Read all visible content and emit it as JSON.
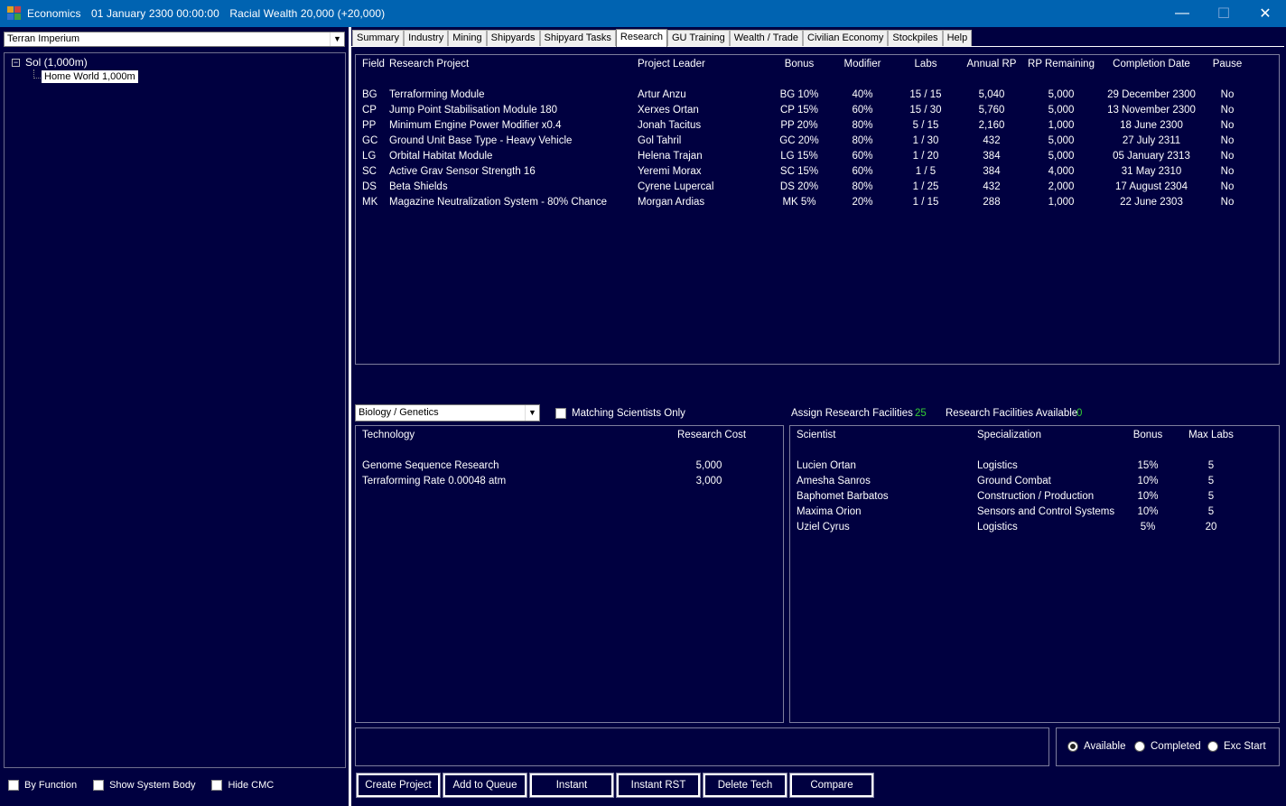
{
  "titlebar": {
    "app_name": "Economics",
    "datetime": "01 January 2300 00:00:00",
    "wealth": "Racial Wealth 20,000 (+20,000)",
    "minimize": "—",
    "maximize": "☐",
    "close": "✕"
  },
  "left": {
    "empire_combo": "Terran Imperium",
    "tree": {
      "expander": "−",
      "system": "Sol  (1,000m)",
      "body": "Home World  1,000m"
    },
    "checks": {
      "by_function": "By Function",
      "show_system_body": "Show System Body",
      "hide_cmc": "Hide CMC"
    }
  },
  "tabs": [
    "Summary",
    "Industry",
    "Mining",
    "Shipyards",
    "Shipyard Tasks",
    "Research",
    "GU Training",
    "Wealth / Trade",
    "Civilian Economy",
    "Stockpiles",
    "Help"
  ],
  "active_tab": "Research",
  "projects": {
    "headers": {
      "field": "Field",
      "project": "Research Project",
      "leader": "Project Leader",
      "bonus": "Bonus",
      "modifier": "Modifier",
      "labs": "Labs",
      "annual_rp": "Annual RP",
      "rp_remaining": "RP Remaining",
      "completion": "Completion Date",
      "pause": "Pause"
    },
    "rows": [
      {
        "field": "BG",
        "project": "Terraforming Module",
        "leader": "Artur Anzu",
        "bonus": "BG 10%",
        "modifier": "40%",
        "labs": "15 / 15",
        "annual_rp": "5,040",
        "rp_remaining": "5,000",
        "completion": "29 December 2300",
        "pause": "No"
      },
      {
        "field": "CP",
        "project": "Jump Point Stabilisation Module 180",
        "leader": "Xerxes Ortan",
        "bonus": "CP 15%",
        "modifier": "60%",
        "labs": "15 / 30",
        "annual_rp": "5,760",
        "rp_remaining": "5,000",
        "completion": "13 November 2300",
        "pause": "No"
      },
      {
        "field": "PP",
        "project": "Minimum Engine Power Modifier x0.4",
        "leader": "Jonah Tacitus",
        "bonus": "PP 20%",
        "modifier": "80%",
        "labs": "5 / 15",
        "annual_rp": "2,160",
        "rp_remaining": "1,000",
        "completion": "18 June 2300",
        "pause": "No"
      },
      {
        "field": "GC",
        "project": "Ground Unit Base Type - Heavy Vehicle",
        "leader": "Gol Tahril",
        "bonus": "GC 20%",
        "modifier": "80%",
        "labs": "1 / 30",
        "annual_rp": "432",
        "rp_remaining": "5,000",
        "completion": "27 July 2311",
        "pause": "No"
      },
      {
        "field": "LG",
        "project": "Orbital Habitat Module",
        "leader": "Helena Trajan",
        "bonus": "LG 15%",
        "modifier": "60%",
        "labs": "1 / 20",
        "annual_rp": "384",
        "rp_remaining": "5,000",
        "completion": "05 January 2313",
        "pause": "No"
      },
      {
        "field": "SC",
        "project": "Active Grav Sensor Strength 16",
        "leader": "Yeremi Morax",
        "bonus": "SC 15%",
        "modifier": "60%",
        "labs": "1 / 5",
        "annual_rp": "384",
        "rp_remaining": "4,000",
        "completion": "31 May 2310",
        "pause": "No"
      },
      {
        "field": "DS",
        "project": "Beta Shields",
        "leader": "Cyrene Lupercal",
        "bonus": "DS 20%",
        "modifier": "80%",
        "labs": "1 / 25",
        "annual_rp": "432",
        "rp_remaining": "2,000",
        "completion": "17 August 2304",
        "pause": "No"
      },
      {
        "field": "MK",
        "project": "Magazine Neutralization System - 80% Chance",
        "leader": "Morgan Ardias",
        "bonus": "MK 5%",
        "modifier": "20%",
        "labs": "1 / 15",
        "annual_rp": "288",
        "rp_remaining": "1,000",
        "completion": "22 June 2303",
        "pause": "No"
      }
    ]
  },
  "research_field_combo": "Biology / Genetics",
  "matching_scientists": "Matching Scientists Only",
  "facilities": {
    "assign_label": "Assign Research Facilities",
    "assign_value": "25",
    "available_label": "Research Facilities Available",
    "available_value": "0"
  },
  "technology": {
    "headers": {
      "technology": "Technology",
      "cost": "Research Cost"
    },
    "rows": [
      {
        "name": "Genome Sequence Research",
        "cost": "5,000"
      },
      {
        "name": "Terraforming Rate 0.00048 atm",
        "cost": "3,000"
      }
    ]
  },
  "scientists": {
    "headers": {
      "scientist": "Scientist",
      "specialization": "Specialization",
      "bonus": "Bonus",
      "max_labs": "Max Labs"
    },
    "rows": [
      {
        "name": "Lucien Ortan",
        "specialization": "Logistics",
        "bonus": "15%",
        "max_labs": "5"
      },
      {
        "name": "Amesha Sanros",
        "specialization": "Ground Combat",
        "bonus": "10%",
        "max_labs": "5"
      },
      {
        "name": "Baphomet Barbatos",
        "specialization": "Construction / Production",
        "bonus": "10%",
        "max_labs": "5"
      },
      {
        "name": "Maxima Orion",
        "specialization": "Sensors and Control Systems",
        "bonus": "10%",
        "max_labs": "5"
      },
      {
        "name": "Uziel Cyrus",
        "specialization": "Logistics",
        "bonus": "5%",
        "max_labs": "20"
      }
    ]
  },
  "radios": {
    "available": "Available",
    "completed": "Completed",
    "exc_start": "Exc Start",
    "selected": "Available"
  },
  "buttons": {
    "create_project": "Create Project",
    "add_to_queue": "Add to Queue",
    "instant": "Instant",
    "instant_rst": "Instant RST",
    "delete_tech": "Delete Tech",
    "compare": "Compare"
  }
}
